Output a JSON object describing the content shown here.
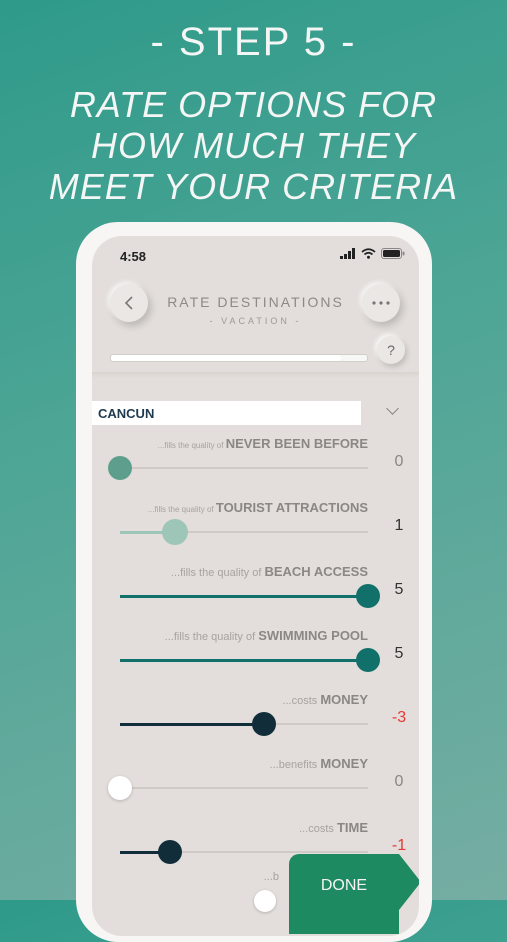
{
  "promo": {
    "step": "- STEP 5 -",
    "tagline": [
      "RATE OPTIONS FOR",
      "HOW MUCH THEY",
      "MEET YOUR CRITERIA"
    ]
  },
  "status_bar": {
    "time": "4:58",
    "icons": [
      "signal-icon",
      "wifi-icon",
      "battery-icon"
    ]
  },
  "header": {
    "back_icon": "chevron-left-icon",
    "title": "RATE DESTINATIONS",
    "subtitle": "- VACATION -",
    "more_icon": "ellipsis-icon",
    "help_label": "?",
    "progress_fraction": 0.9
  },
  "destination": {
    "name": "CANCUN",
    "chevron": "chevron-down-icon"
  },
  "criteria": [
    {
      "prefix": "...fills the quality of ",
      "name": "NEVER BEEN BEFORE",
      "value": "0",
      "slider_fraction": 0.0,
      "color": "#5e9e8d",
      "value_color": "#8a8683"
    },
    {
      "prefix": "...fills the quality of ",
      "name": "TOURIST ATTRACTIONS",
      "value": "1",
      "slider_fraction": 0.22,
      "color": "#9dc6b9",
      "value_color": "#333333"
    },
    {
      "prefix": "...fills the quality of ",
      "name": "BEACH ACCESS",
      "value": "5",
      "slider_fraction": 1.0,
      "color": "#11706a",
      "value_color": "#333333"
    },
    {
      "prefix": "...fills the quality of ",
      "name": "SWIMMING POOL",
      "value": "5",
      "slider_fraction": 1.0,
      "color": "#11706a",
      "value_color": "#333333"
    },
    {
      "prefix": "...costs ",
      "name": "MONEY",
      "value": "-3",
      "slider_fraction": 0.58,
      "color": "#122d3a",
      "value_color": "#e53935"
    },
    {
      "prefix": "...benefits ",
      "name": "MONEY",
      "value": "0",
      "slider_fraction": 0.0,
      "color": "#ffffff",
      "value_color": "#8a8683"
    },
    {
      "prefix": "...costs ",
      "name": "TIME",
      "value": "-1",
      "slider_fraction": 0.2,
      "color": "#122d3a",
      "value_color": "#e53935"
    }
  ],
  "partial_row": {
    "prefix": "...b"
  },
  "done_label": "DONE"
}
